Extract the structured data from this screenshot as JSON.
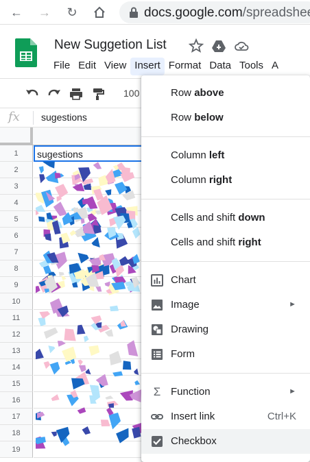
{
  "browser": {
    "url_host": "docs.google.com",
    "url_path": "/spreadsheets"
  },
  "doc": {
    "title": "New Suggetion List",
    "menu": [
      "File",
      "Edit",
      "View",
      "Insert",
      "Format",
      "Data",
      "Tools",
      "A"
    ]
  },
  "toolbar": {
    "zoom": "100"
  },
  "formula_bar": {
    "fx": "fx",
    "value": "sugestions"
  },
  "sheet": {
    "rows": [
      "1",
      "2",
      "3",
      "4",
      "5",
      "6",
      "7",
      "8",
      "9",
      "10",
      "11",
      "12",
      "13",
      "14",
      "15",
      "16",
      "17",
      "18",
      "19"
    ],
    "cell_a1": "sugestions"
  },
  "insert_menu": {
    "row_above": {
      "prefix": "Row ",
      "bold": "above"
    },
    "row_below": {
      "prefix": "Row ",
      "bold": "below"
    },
    "column_left": {
      "prefix": "Column ",
      "bold": "left"
    },
    "column_right": {
      "prefix": "Column ",
      "bold": "right"
    },
    "cells_down": {
      "prefix": "Cells and shift ",
      "bold": "down"
    },
    "cells_right": {
      "prefix": "Cells and shift ",
      "bold": "right"
    },
    "chart": "Chart",
    "image": "Image",
    "drawing": "Drawing",
    "form": "Form",
    "function": "Function",
    "insert_link": "Insert link",
    "insert_link_shortcut": "Ctrl+K",
    "checkbox": "Checkbox"
  },
  "colors": {
    "accent": "#1a73e8",
    "sheets_green": "#0f9d58",
    "menu_active": "#e8f0fe"
  }
}
